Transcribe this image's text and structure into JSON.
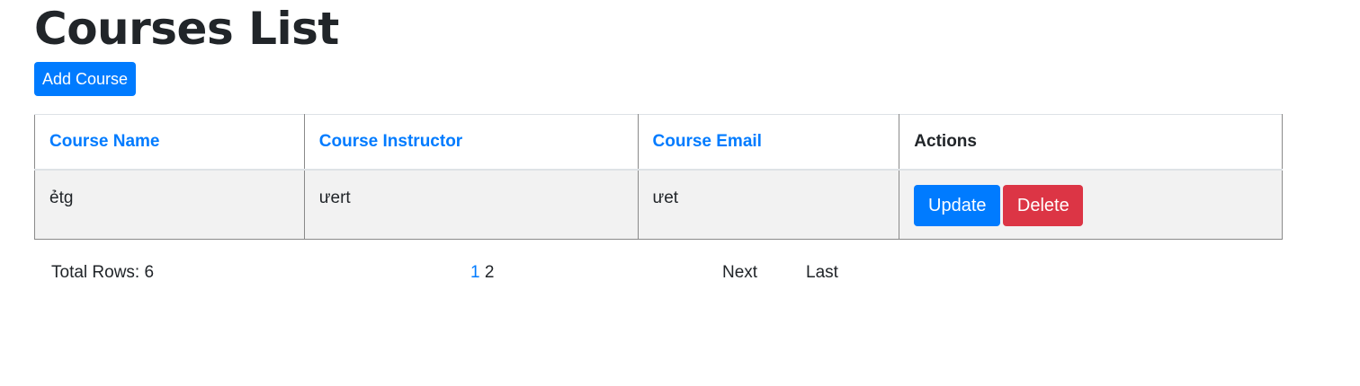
{
  "page": {
    "title": "Courses List",
    "add_button_label": "Add Course"
  },
  "table": {
    "headers": [
      "Course Name",
      "Course Instructor",
      "Course Email",
      "Actions"
    ],
    "rows": [
      {
        "name": "ẻtg",
        "instructor": "ưert",
        "email": "ưet",
        "update_label": "Update",
        "delete_label": "Delete"
      }
    ]
  },
  "pagination": {
    "total_rows_text": "Total Rows: 6",
    "pages": [
      "1",
      "2"
    ],
    "active_page": "1",
    "next_label": "Next",
    "last_label": "Last"
  },
  "colors": {
    "primary": "#007bff",
    "danger": "#dc3545",
    "row_background": "#f2f2f2"
  }
}
